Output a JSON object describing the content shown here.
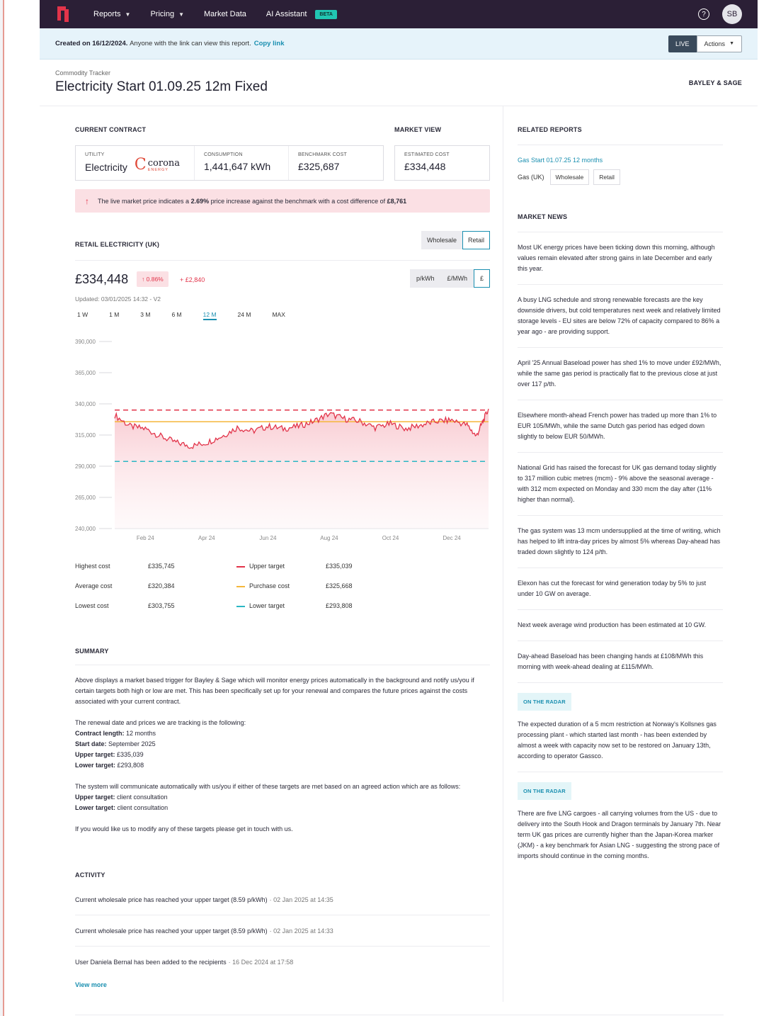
{
  "nav": {
    "items": [
      {
        "label": "Reports",
        "has_menu": true
      },
      {
        "label": "Pricing",
        "has_menu": true
      },
      {
        "label": "Market Data",
        "has_menu": false
      },
      {
        "label": "AI Assistant",
        "has_menu": false
      }
    ],
    "beta_badge": "BETA",
    "avatar_initials": "SB",
    "icons": {
      "logo": "brand-logo-icon",
      "help": "help-icon"
    }
  },
  "notice": {
    "created": "Created on 16/12/2024.",
    "text": "Anyone with the link can view this report.",
    "link": "Copy link",
    "live": "LIVE",
    "actions": "Actions"
  },
  "header": {
    "subtitle": "Commodity Tracker",
    "title": "Electricity Start 01.09.25 12m Fixed",
    "brand": "BAYLEY & SAGE"
  },
  "contract": {
    "section_label": "CURRENT CONTRACT",
    "market_view_label": "MARKET VIEW",
    "utility_label": "UTILITY",
    "utility_value": "Electricity",
    "supplier_logo_text": "corona",
    "supplier_logo_sub": "ENERGY",
    "consumption_label": "CONSUMPTION",
    "consumption_value": "1,441,647 kWh",
    "benchmark_label": "BENCHMARK COST",
    "benchmark_value": "£325,687",
    "estimated_label": "ESTIMATED COST",
    "estimated_value": "£334,448"
  },
  "alert": {
    "text_1": "The live market price indicates a",
    "pct": "2.69%",
    "text_2": "price increase against the benchmark with a cost difference of",
    "amount": "£8,761",
    "color": "#e2344a"
  },
  "chart_section": {
    "label": "RETAIL ELECTRICITY (UK)",
    "tabs": [
      "Wholesale",
      "Retail"
    ],
    "active_tab": "Retail",
    "price": "£334,448",
    "change_pct": "0.86%",
    "change_abs": "+ £2,840",
    "units": [
      "p/kWh",
      "£/MWh",
      "£"
    ],
    "active_unit": "£",
    "updated": "Updated: 03/01/2025 14:32 - V2",
    "ranges": [
      "1 W",
      "1 M",
      "3 M",
      "6 M",
      "12 M",
      "24 M",
      "MAX"
    ],
    "active_range": "12 M"
  },
  "chart_data": {
    "type": "line",
    "ylim": [
      240000,
      390000
    ],
    "y_ticks": [
      "390,000",
      "365,000",
      "340,000",
      "315,000",
      "290,000",
      "265,000",
      "240,000"
    ],
    "y_tick_values": [
      390000,
      365000,
      340000,
      315000,
      290000,
      265000,
      240000
    ],
    "x_ticks": [
      "Feb 24",
      "Apr 24",
      "Jun 24",
      "Aug 24",
      "Oct 24",
      "Dec 24"
    ],
    "x_tick_positions": [
      1,
      3,
      5,
      7,
      9,
      11
    ],
    "x_range": [
      0,
      12.2
    ],
    "series": [
      {
        "key": "cost",
        "color": "#e2344a",
        "x": [
          0,
          0.5,
          1.0,
          1.5,
          2.0,
          2.5,
          3.0,
          3.5,
          4.0,
          4.5,
          5.0,
          5.5,
          6.0,
          6.5,
          7.0,
          7.5,
          8.0,
          8.5,
          9.0,
          9.5,
          10.0,
          10.5,
          11.0,
          11.5,
          11.8,
          12.0,
          12.2
        ],
        "values": [
          331000,
          322000,
          320000,
          314000,
          309000,
          306000,
          309000,
          314000,
          321000,
          318000,
          322000,
          320000,
          322000,
          326000,
          332000,
          328000,
          326000,
          321000,
          324000,
          320000,
          323000,
          326000,
          327000,
          323000,
          314000,
          325000,
          336000
        ]
      }
    ],
    "reference_lines": [
      {
        "name": "Upper target",
        "value": 335039,
        "color": "#e2344a",
        "dashed": true
      },
      {
        "name": "Purchase cost",
        "value": 325668,
        "color": "#f5b73b",
        "dashed": false
      },
      {
        "name": "Lower target",
        "value": 293808,
        "color": "#2bb7c4",
        "dashed": true
      }
    ],
    "grid": false,
    "area_fill": true
  },
  "stats": {
    "highest_label": "Highest cost",
    "highest_value": "£335,745",
    "average_label": "Average cost",
    "average_value": "£320,384",
    "lowest_label": "Lowest cost",
    "lowest_value": "£303,755",
    "upper_label": "Upper target",
    "upper_value": "£335,039",
    "purchase_label": "Purchase cost",
    "purchase_value": "£325,668",
    "lower_label": "Lower target",
    "lower_value": "£293,808"
  },
  "summary": {
    "label": "SUMMARY",
    "p1": "Above displays a market based trigger for Bayley & Sage which will monitor energy prices automatically in the background and notify us/you if certain targets both high or low are met. This has been specifically set up for your renewal and compares the future prices against the costs associated with your current contract.",
    "p2_intro": "The renewal date and prices we are tracking is the following:",
    "contract_length_label": "Contract length:",
    "contract_length": "12 months",
    "start_date_label": "Start date:",
    "start_date": "September 2025",
    "upper_target_label": "Upper target:",
    "upper_target": "£335,039",
    "lower_target_label": "Lower target:",
    "lower_target": "£293,808",
    "p3_intro": "The system will communicate automatically with us/you if either of these targets are met based on an agreed action which are as follows:",
    "upper_action_label": "Upper target:",
    "upper_action": "client consultation",
    "lower_action_label": "Lower target:",
    "lower_action": "client consultation",
    "p4": "If you would like us to modify any of these targets please get in touch with us."
  },
  "activity": {
    "label": "ACTIVITY",
    "items": [
      {
        "text": "Current wholesale price has reached your upper target (8.59 p/kWh)",
        "ts": "· 02 Jan 2025 at 14:35"
      },
      {
        "text": "Current wholesale price has reached your upper target (8.59 p/kWh)",
        "ts": "· 02 Jan 2025 at 14:33"
      },
      {
        "text": "User Daniela Bernal has been added to the recipients",
        "ts": "· 16 Dec 2024 at 17:58"
      }
    ],
    "view_more": "View more"
  },
  "related": {
    "label": "RELATED REPORTS",
    "link": "Gas Start 01.07.25 12 months",
    "tag_text": "Gas (UK)",
    "tags": [
      "Wholesale",
      "Retail"
    ]
  },
  "news": {
    "label": "MARKET NEWS",
    "radar_label": "ON THE RADAR",
    "items": [
      "Most UK energy prices have been ticking down this morning, although values remain elevated after strong gains in late December and early this year.",
      "A busy LNG schedule and strong renewable forecasts are the key downside drivers, but cold temperatures next week and relatively limited storage levels - EU sites are below 72% of capacity compared to 86% a year ago - are providing support.",
      "April '25 Annual Baseload power has shed 1% to move under £92/MWh, while the same gas period is practically flat to the previous close at just over 117 p/th.",
      "Elsewhere month-ahead French power has traded up more than 1% to EUR 105/MWh, while the same Dutch gas period has edged down slightly to below EUR 50/MWh.",
      "National Grid has raised the forecast for UK gas demand today slightly to 317 million cubic metres (mcm) - 9% above the seasonal average - with 312 mcm expected on Monday and 330 mcm the day after (11% higher than normal).",
      "The gas system was 13 mcm undersupplied at the time of writing, which has helped to lift intra-day prices by almost 5% whereas Day-ahead has traded down slightly to 124 p/th.",
      "Elexon has cut the forecast for wind generation today by 5% to just under 10 GW on average.",
      "Next week average wind production has been estimated at 10 GW.",
      "Day-ahead Baseload has been changing hands at £108/MWh this morning with week-ahead dealing at £115/MWh."
    ],
    "radar_items": [
      "The expected duration of a 5 mcm restriction at Norway's Kollsnes gas processing plant - which started last month - has been extended by almost a week with capacity now set to be restored on January 13th, according to operator Gassco.",
      "There are five LNG cargoes - all carrying volumes from the US - due to delivery into the South Hook and Dragon terminals by January 7th. Near term UK gas prices are currently higher than the Japan-Korea marker (JKM) - a key benchmark for Asian LNG - suggesting the strong pace of imports should continue in the coming months."
    ]
  },
  "colors": {
    "nav_bg": "#2b1f36",
    "accent": "#1a8fb0",
    "alert": "#e2344a",
    "teal": "#21c6b2"
  }
}
